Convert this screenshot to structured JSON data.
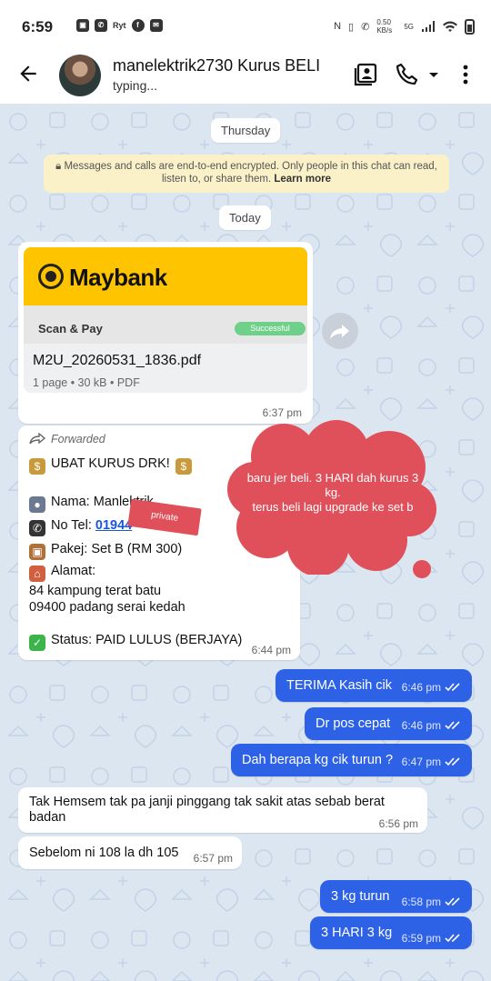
{
  "status_bar": {
    "time": "6:59",
    "right_text": "0.50 KB/s",
    "network": "5G"
  },
  "app_bar": {
    "name": "manelektrik2730 Kurus BELI",
    "subtitle": "typing..."
  },
  "chat": {
    "day1": "Thursday",
    "encryption_notice": "Messages and calls are end-to-end encrypted. Only people in this chat can read, listen to, or share them.",
    "learn_more": "Learn more",
    "day2": "Today",
    "pdf": {
      "brand": "Maybank",
      "subtitle": "Scan & Pay",
      "status": "Successful",
      "filename": "M2U_20260531_1836.pdf",
      "info": "1 page • 30 kB • PDF",
      "time": "6:37 pm"
    },
    "forwarded_message": {
      "label": "Forwarded",
      "title": "UBAT KURUS DRK!",
      "nama": "Nama: Manlektrik",
      "tel_label": "No Tel: ",
      "tel_value": "01944",
      "pakej": "Pakej: Set B (RM 300)",
      "alamat_label": "Alamat:",
      "alamat_line1": "84 kampung terat batu",
      "alamat_line2": "09400 padang serai kedah",
      "status": "Status: PAID LULUS (BERJAYA)",
      "time": "6:44 pm"
    },
    "overlay_note": "baru jer beli. 3 HARI dah kurus 3 kg.\nterus beli lagi upgrade ke set b",
    "private_label": "private",
    "messages": [
      {
        "dir": "out",
        "text": "TERIMA Kasih cik",
        "time": "6:46 pm"
      },
      {
        "dir": "out",
        "text": "Dr pos cepat",
        "time": "6:46 pm"
      },
      {
        "dir": "out",
        "text": "Dah berapa kg cik turun ?",
        "time": "6:47 pm"
      },
      {
        "dir": "in",
        "text": "Tak Hemsem tak  pa janji pinggang tak sakit atas sebab berat badan",
        "time": "6:56 pm"
      },
      {
        "dir": "in",
        "text": "Sebelom ni 108 la dh 105",
        "time": "6:57 pm"
      },
      {
        "dir": "out",
        "text": "3 kg turun",
        "time": "6:58 pm"
      },
      {
        "dir": "out",
        "text": "3 HARI 3 kg",
        "time": "6:59 pm"
      }
    ]
  }
}
